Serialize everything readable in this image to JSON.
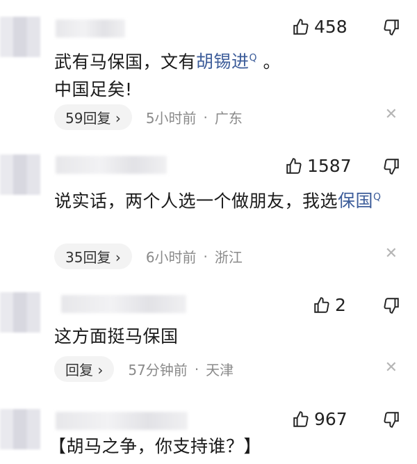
{
  "comments": [
    {
      "likes": "458",
      "text_before": "武有马保国，文有",
      "link": "胡锡进",
      "text_after": " 。",
      "line2": "中国足矣!",
      "replies": "59回复",
      "time": "5小时前",
      "location": "广东"
    },
    {
      "likes": "1587",
      "text_before": "说实话，两个人选一个做朋友，我选",
      "link": "保国",
      "replies": "35回复",
      "time": "6小时前",
      "location": "浙江"
    },
    {
      "likes": "2",
      "text": "这方面挺马保国",
      "replies": "回复",
      "time": "57分钟前",
      "location": "天津"
    },
    {
      "likes": "967",
      "text": "【胡马之争，你支持谁？】"
    }
  ],
  "icons": {
    "search_mark": "Q",
    "chevron": "›",
    "close": "✕",
    "dot": "·"
  }
}
